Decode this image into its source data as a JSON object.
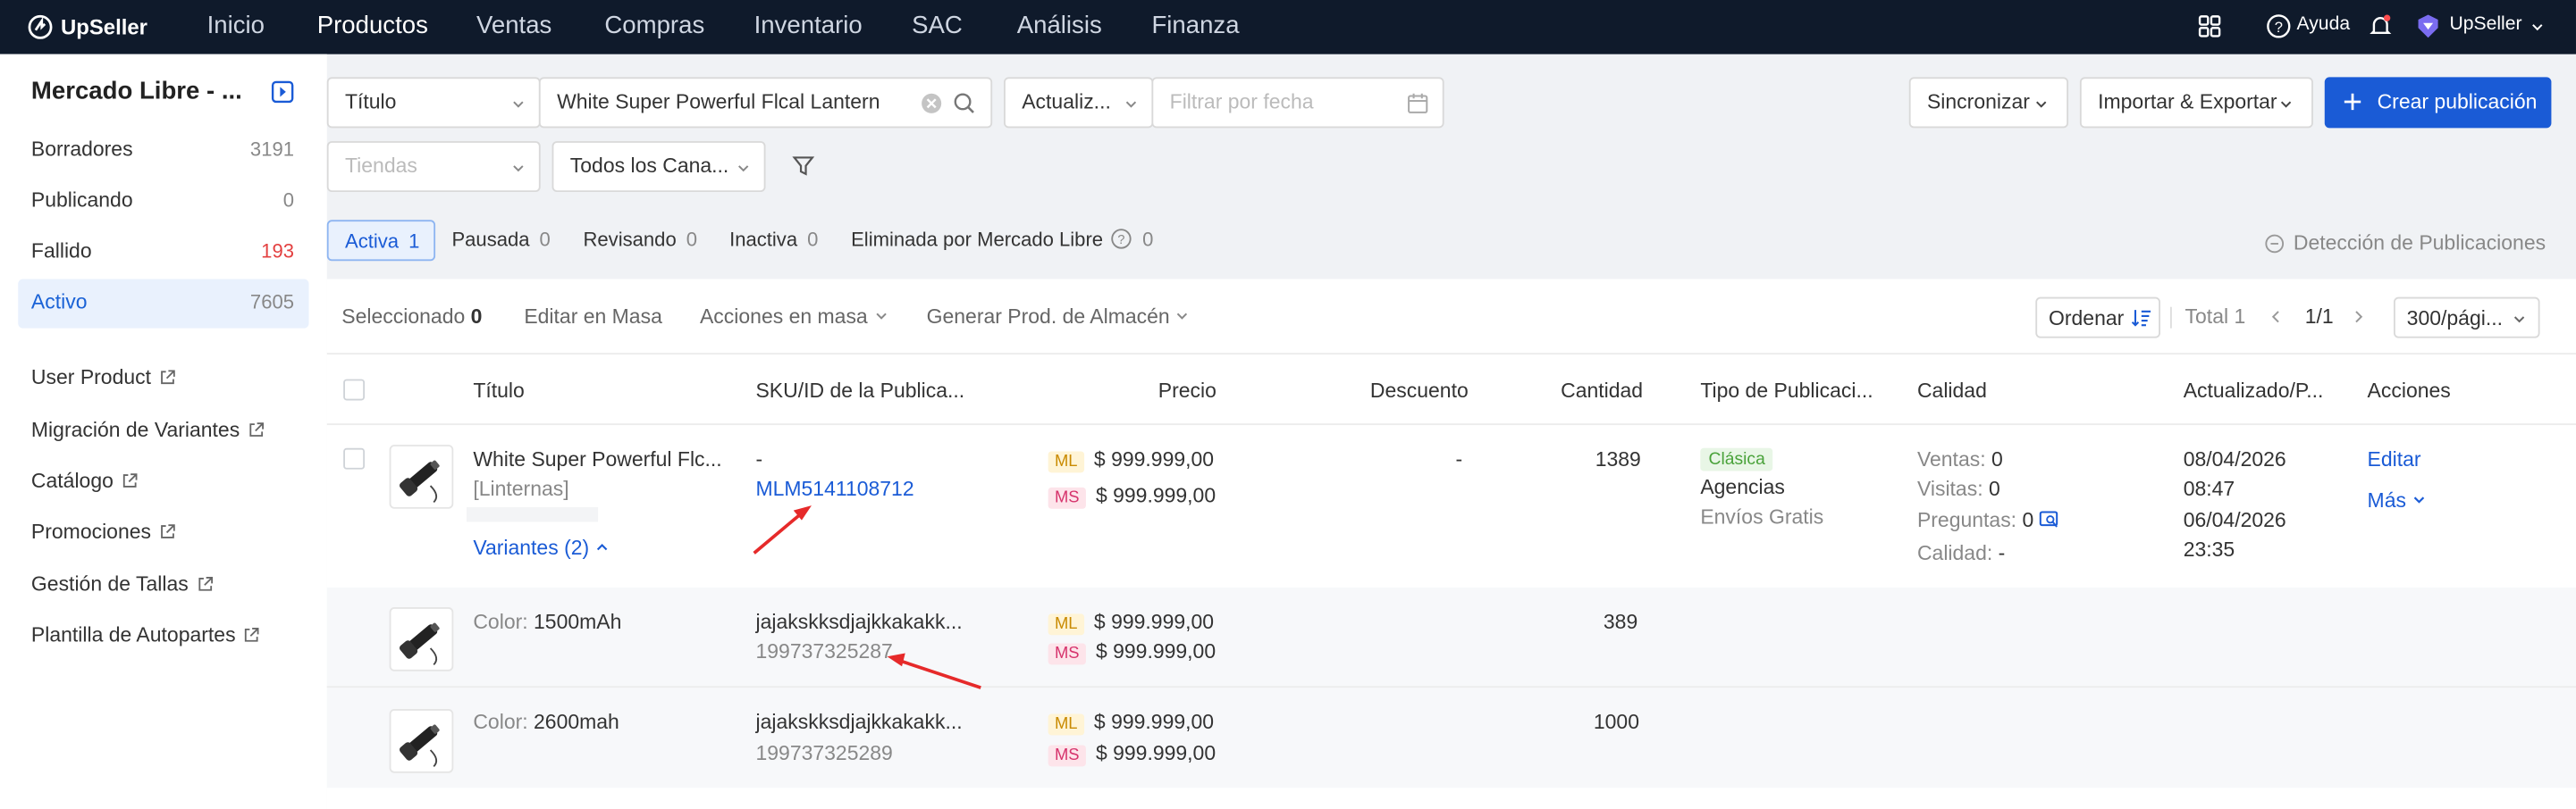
{
  "app": {
    "brand": "UpSeller",
    "nav": [
      "Inicio",
      "Productos",
      "Ventas",
      "Compras",
      "Inventario",
      "SAC",
      "Análisis",
      "Finanza"
    ],
    "help_label": "Ayuda",
    "user_label": "UpSeller"
  },
  "sidebar": {
    "title": "Mercado Libre - ...",
    "status_items": [
      {
        "label": "Borradores",
        "count": "3191"
      },
      {
        "label": "Publicando",
        "count": "0"
      },
      {
        "label": "Fallido",
        "count": "193"
      },
      {
        "label": "Activo",
        "count": "7605"
      }
    ],
    "links": [
      "User Product",
      "Migración de Variantes",
      "Catálogo",
      "Promociones",
      "Gestión de Tallas",
      "Plantilla de Autopartes"
    ]
  },
  "filters": {
    "search_field": "Título",
    "search_value": "White Super Powerful Flcal Lantern",
    "date_field": "Actualiz...",
    "date_placeholder": "Filtrar por fecha",
    "store_placeholder": "Tiendas",
    "channel": "Todos los Cana...",
    "sync_label": "Sincronizar",
    "import_export_label": "Importar & Exportar",
    "create_label": "Crear publicación"
  },
  "tabs": [
    {
      "label": "Activa",
      "count": "1"
    },
    {
      "label": "Pausada",
      "count": "0"
    },
    {
      "label": "Revisando",
      "count": "0"
    },
    {
      "label": "Inactiva",
      "count": "0"
    },
    {
      "label": "Eliminada por Mercado Libre",
      "count": "0"
    }
  ],
  "detection_label": "Detección de Publicaciones",
  "toolbar": {
    "selected_label": "Seleccionado",
    "selected_count": "0",
    "bulk_edit": "Editar en Masa",
    "bulk_actions": "Acciones en masa",
    "generate": "Generar Prod. de Almacén",
    "sort": "Ordenar",
    "total": "Total 1",
    "page": "1/1",
    "page_size": "300/pági..."
  },
  "table": {
    "headers": [
      "Título",
      "SKU/ID de la Publica...",
      "Precio",
      "Descuento",
      "Cantidad",
      "Tipo de Publicaci...",
      "Calidad",
      "Actualizado/P...",
      "Acciones"
    ],
    "row": {
      "title": "White Super Powerful Flc...",
      "category": "[Linternas]",
      "variants_label": "Variantes (2)",
      "sku": "-",
      "item_id": "MLM5141108712",
      "ml_tag": "ML",
      "ms_tag": "MS",
      "price_ml": "$ 999.999,00",
      "price_ms": "$ 999.999,00",
      "discount": "-",
      "quantity": "1389",
      "listing_type": "Clásica",
      "listing_mode": "Agencias",
      "shipping": "Envíos Gratis",
      "quality": [
        {
          "label": "Ventas:",
          "value": "0"
        },
        {
          "label": "Visitas:",
          "value": "0"
        },
        {
          "label": "Preguntas:",
          "value": "0"
        },
        {
          "label": "Calidad:",
          "value": "-"
        }
      ],
      "updated_date": "08/04/2026",
      "updated_time": "08:47",
      "published_date": "06/04/2026",
      "published_time": "23:35",
      "edit_label": "Editar",
      "more_label": "Más"
    },
    "variants": [
      {
        "attr_label": "Color:",
        "attr_value": "1500mAh",
        "sku": "jajakskksdjajkkakakk...",
        "id": "199737325287",
        "price_ml": "$ 999.999,00",
        "price_ms": "$ 999.999,00",
        "quantity": "389"
      },
      {
        "attr_label": "Color:",
        "attr_value": "2600mah",
        "sku": "jajakskksdjajkkakakk...",
        "id": "199737325289",
        "price_ml": "$ 999.999,00",
        "price_ms": "$ 999.999,00",
        "quantity": "1000"
      }
    ]
  },
  "colors": {
    "topbar": "#0f1a2b",
    "primary": "#1a5bd6",
    "active_bg": "#e9f1fd",
    "error": "#e34040",
    "annotation": "#e62a2a"
  }
}
